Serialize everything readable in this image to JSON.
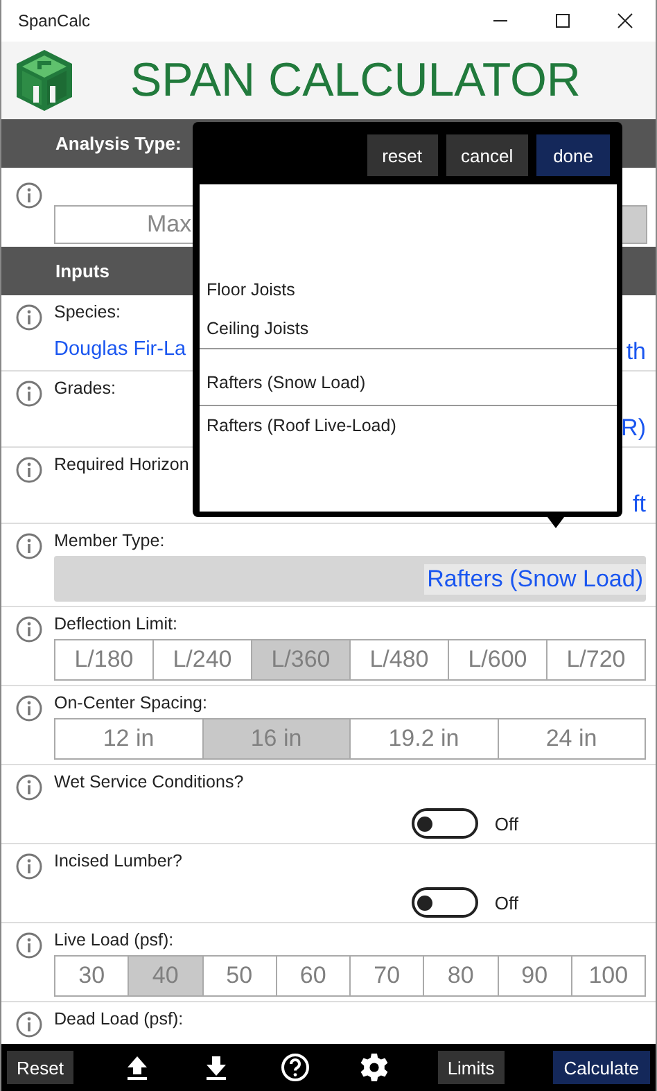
{
  "window": {
    "title": "SpanCalc"
  },
  "header": {
    "title": "SPAN CALCULATOR"
  },
  "analysis": {
    "title": "Analysis Type:",
    "visible_text": "Max"
  },
  "inputs": {
    "title": "Inputs",
    "rows": [
      {
        "kind": "value",
        "label": "Species:",
        "value_left": "Douglas Fir-La",
        "value_right": "th"
      },
      {
        "kind": "value",
        "label": "Grades:",
        "value_right": "R)"
      },
      {
        "kind": "value",
        "label": "Required Horizon",
        "value_right": "ft"
      },
      {
        "kind": "select",
        "label": "Member Type:",
        "value": "Rafters (Snow Load)"
      },
      {
        "kind": "segments",
        "label": "Deflection Limit:",
        "options": [
          {
            "label": "L/180",
            "selected": false
          },
          {
            "label": "L/240",
            "selected": false
          },
          {
            "label": "L/360",
            "selected": true
          },
          {
            "label": "L/480",
            "selected": false
          },
          {
            "label": "L/600",
            "selected": false
          },
          {
            "label": "L/720",
            "selected": false
          }
        ]
      },
      {
        "kind": "segments",
        "label": "On-Center Spacing:",
        "options": [
          {
            "label": "12 in",
            "selected": false
          },
          {
            "label": "16 in",
            "selected": true
          },
          {
            "label": "19.2 in",
            "selected": false
          },
          {
            "label": "24 in",
            "selected": false
          }
        ]
      },
      {
        "kind": "toggle",
        "label": "Wet Service Conditions?",
        "on": false,
        "state_text": "Off"
      },
      {
        "kind": "toggle",
        "label": "Incised Lumber?",
        "on": false,
        "state_text": "Off"
      },
      {
        "kind": "segments",
        "label": "Live Load (psf):",
        "options": [
          {
            "label": "30",
            "selected": false
          },
          {
            "label": "40",
            "selected": true
          },
          {
            "label": "50",
            "selected": false
          },
          {
            "label": "60",
            "selected": false
          },
          {
            "label": "70",
            "selected": false
          },
          {
            "label": "80",
            "selected": false
          },
          {
            "label": "90",
            "selected": false
          },
          {
            "label": "100",
            "selected": false
          }
        ]
      },
      {
        "kind": "label",
        "label": "Dead Load (psf):"
      }
    ]
  },
  "picker": {
    "buttons": [
      {
        "label": "reset",
        "kind": "plain"
      },
      {
        "label": "cancel",
        "kind": "plain"
      },
      {
        "label": "done",
        "kind": "primary"
      }
    ],
    "items": [
      {
        "label": "Floor Joists",
        "selected": false
      },
      {
        "label": "Ceiling Joists",
        "selected": false
      },
      {
        "label": "Rafters (Snow Load)",
        "selected": true
      },
      {
        "label": "Rafters (Roof Live-Load)",
        "selected": false
      }
    ]
  },
  "toolbar": [
    {
      "kind": "text",
      "label": "Reset"
    },
    {
      "kind": "upload"
    },
    {
      "kind": "download"
    },
    {
      "kind": "help"
    },
    {
      "kind": "settings"
    },
    {
      "kind": "text",
      "label": "Limits"
    },
    {
      "kind": "primary",
      "label": "Calculate"
    }
  ]
}
